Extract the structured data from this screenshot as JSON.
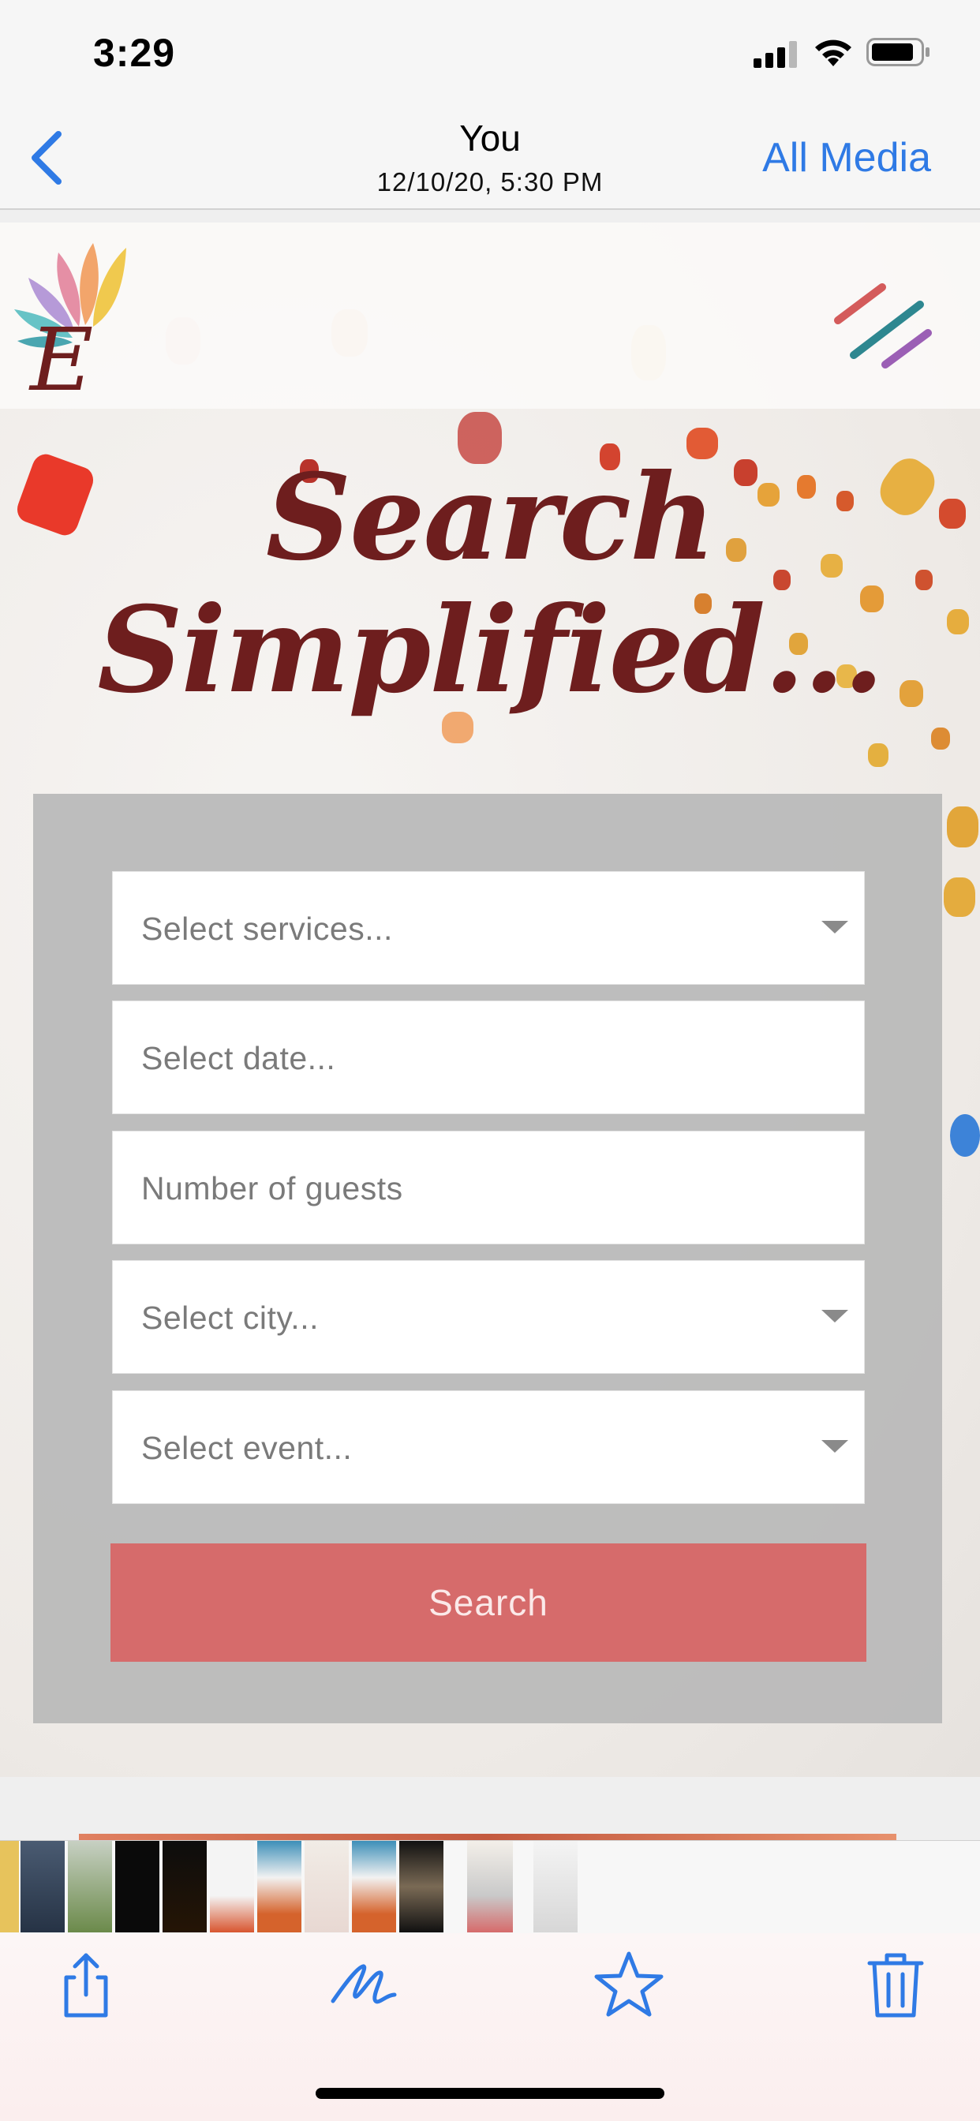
{
  "status": {
    "time": "3:29"
  },
  "nav": {
    "title": "You",
    "subtitle": "12/10/20, 5:30 PM",
    "all_media_label": "All Media"
  },
  "site": {
    "hero_title_line1": "Search",
    "hero_title_line2": "Simplified...",
    "form": {
      "services_placeholder": "Select services...",
      "date_placeholder": "Select date...",
      "guests_placeholder": "Number of guests",
      "city_placeholder": "Select city...",
      "event_placeholder": "Select event...",
      "search_label": "Search"
    }
  },
  "colors": {
    "accent_blue": "#2f7ae5",
    "hero_title": "#6e1e1e",
    "search_button": "#d66b6b",
    "panel_gray": "#bababa"
  },
  "icons": {
    "back": "chevron-left-icon",
    "signal": "cellular-signal-icon",
    "wifi": "wifi-icon",
    "battery": "battery-icon",
    "menu": "menu-icon",
    "share": "share-icon",
    "markup": "markup-icon",
    "favorite": "star-icon",
    "delete": "trash-icon"
  }
}
